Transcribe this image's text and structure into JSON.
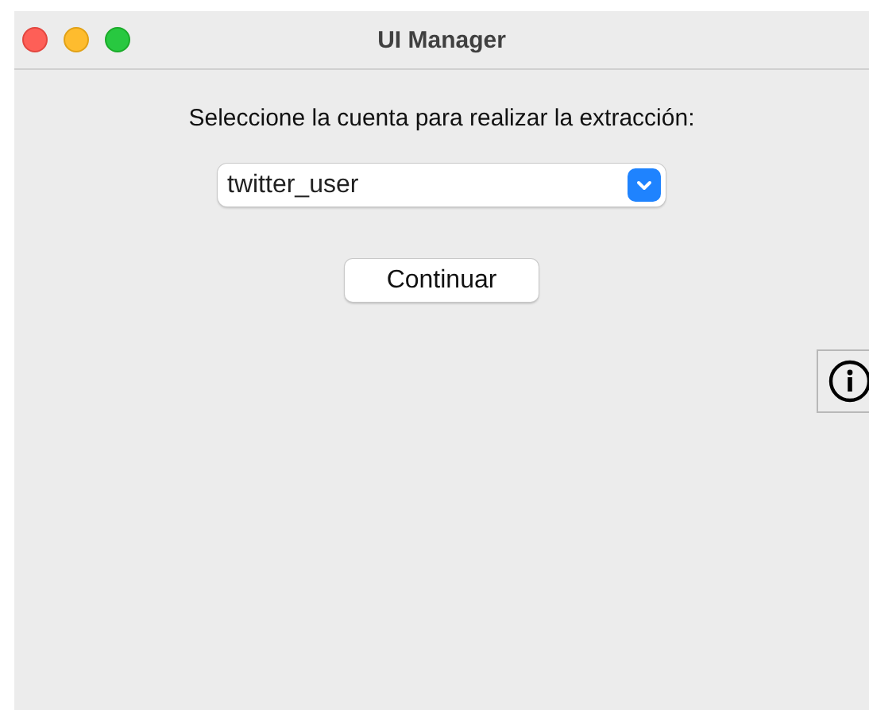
{
  "window": {
    "title": "UI Manager"
  },
  "prompt": "Seleccione la cuenta para realizar la extracción:",
  "account_select": {
    "value": "twitter_user"
  },
  "buttons": [
    "Continuar"
  ]
}
